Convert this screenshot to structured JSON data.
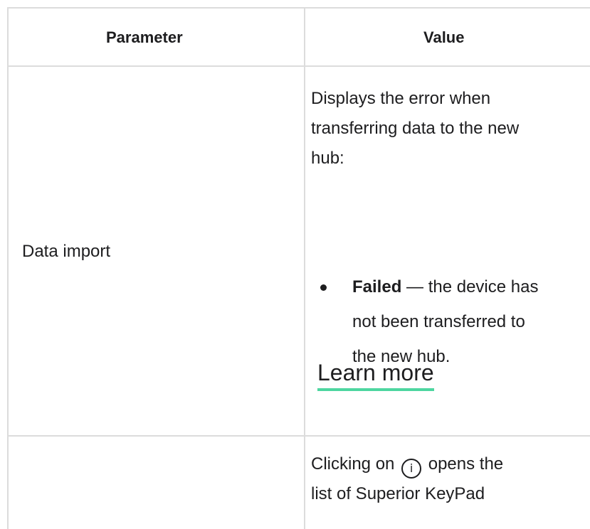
{
  "table": {
    "header": {
      "parameter": "Parameter",
      "value": "Value"
    },
    "rows": [
      {
        "parameter": "Data import",
        "value_intro_lines": [
          "Displays the error when",
          "transferring data to the new",
          "hub:"
        ],
        "bullet": {
          "term": "Failed",
          "separator": " — ",
          "line1_rest": "the device has",
          "line2": "not been transferred to",
          "line3": "the new hub."
        },
        "link": "Learn more"
      },
      {
        "parameter": "",
        "value_line1_before_icon": "Clicking on ",
        "icon_glyph": "i",
        "value_line1_after_icon": " opens the",
        "value_line2": "list of Superior KeyPad"
      }
    ]
  },
  "colors": {
    "border": "#dcdcdc",
    "text": "#1d1d1f",
    "link_underline": "#4ed6a0"
  },
  "icons": {
    "info": "info-icon"
  }
}
